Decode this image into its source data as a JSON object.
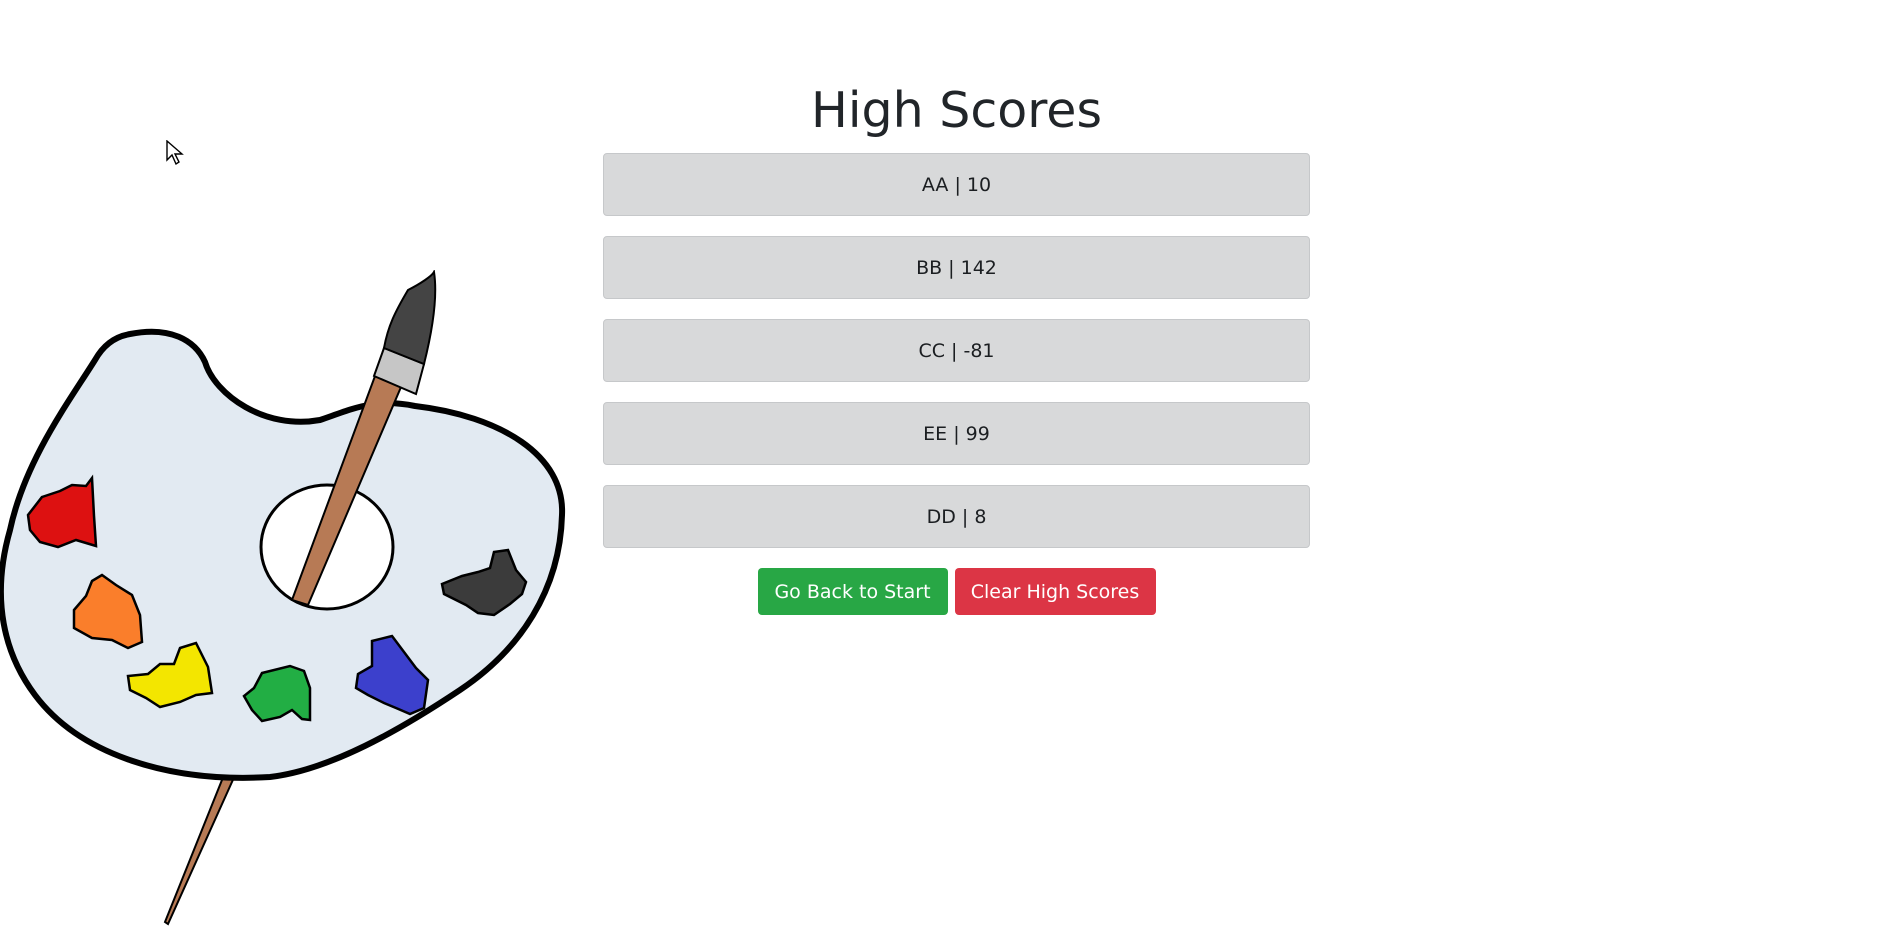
{
  "title": "High Scores",
  "scores": [
    {
      "text": "AA | 10"
    },
    {
      "text": "BB | 142"
    },
    {
      "text": "CC | -81"
    },
    {
      "text": "EE | 99"
    },
    {
      "text": "DD | 8"
    }
  ],
  "buttons": {
    "back": "Go Back to Start",
    "clear": "Clear High Scores"
  },
  "colors": {
    "success": "#28a745",
    "danger": "#dc3545",
    "list_bg": "#d8d9da"
  },
  "art": {
    "icon": "paint-palette-icon"
  }
}
